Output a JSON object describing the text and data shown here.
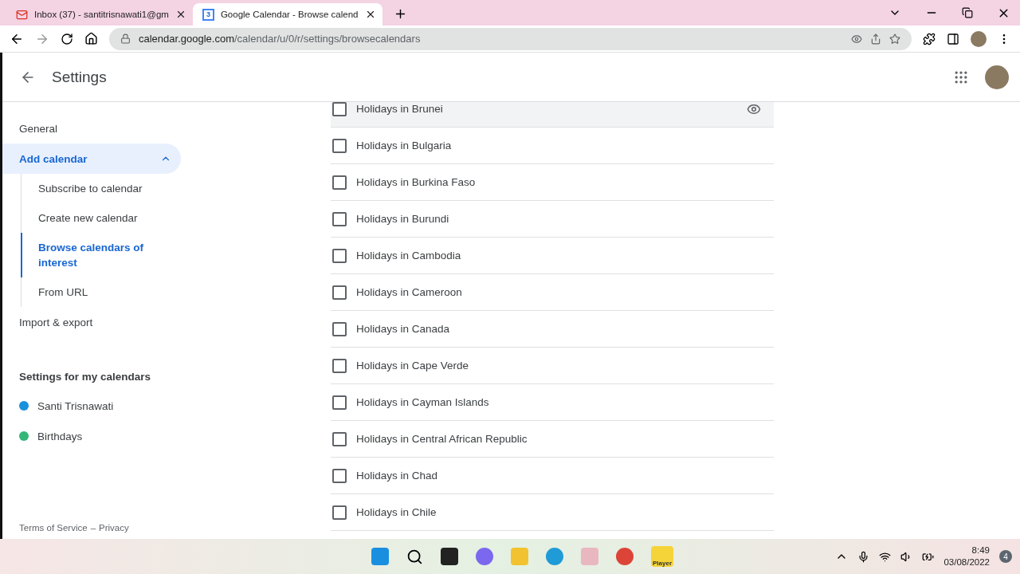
{
  "browser": {
    "tabs": [
      {
        "title": "Inbox (37) - santitrisnawati1@gm",
        "selected": false,
        "kind": "mail"
      },
      {
        "title": "Google Calendar - Browse calend",
        "selected": true,
        "kind": "calendar",
        "icon_text": "3"
      }
    ],
    "url_host": "calendar.google.com",
    "url_path": "/calendar/u/0/r/settings/browsecalendars"
  },
  "header": {
    "title": "Settings"
  },
  "sidebar": {
    "nav": [
      {
        "label": "General",
        "selected": false
      },
      {
        "label": "Add calendar",
        "selected": true,
        "expanded": true,
        "children": [
          {
            "label": "Subscribe to calendar",
            "selected": false
          },
          {
            "label": "Create new calendar",
            "selected": false
          },
          {
            "label": "Browse calendars of interest",
            "selected": true
          },
          {
            "label": "From URL",
            "selected": false
          }
        ]
      },
      {
        "label": "Import & export",
        "selected": false
      }
    ],
    "section_title": "Settings for my calendars",
    "calendars": [
      {
        "name": "Santi Trisnawati",
        "color": "#1a8fdc"
      },
      {
        "name": "Birthdays",
        "color": "#33b679"
      }
    ],
    "footer_terms": "Terms of Service",
    "footer_sep": "–",
    "footer_privacy": "Privacy"
  },
  "holidays": [
    {
      "label": "Holidays in Brunei",
      "checked": false,
      "hovered": true
    },
    {
      "label": "Holidays in Bulgaria",
      "checked": false,
      "hovered": false
    },
    {
      "label": "Holidays in Burkina Faso",
      "checked": false,
      "hovered": false
    },
    {
      "label": "Holidays in Burundi",
      "checked": false,
      "hovered": false
    },
    {
      "label": "Holidays in Cambodia",
      "checked": false,
      "hovered": false
    },
    {
      "label": "Holidays in Cameroon",
      "checked": false,
      "hovered": false
    },
    {
      "label": "Holidays in Canada",
      "checked": false,
      "hovered": false
    },
    {
      "label": "Holidays in Cape Verde",
      "checked": false,
      "hovered": false
    },
    {
      "label": "Holidays in Cayman Islands",
      "checked": false,
      "hovered": false
    },
    {
      "label": "Holidays in Central African Republic",
      "checked": false,
      "hovered": false
    },
    {
      "label": "Holidays in Chad",
      "checked": false,
      "hovered": false
    },
    {
      "label": "Holidays in Chile",
      "checked": false,
      "hovered": false
    }
  ],
  "taskbar": {
    "player_label": "Player",
    "time": "8:49",
    "date": "03/08/2022",
    "notifications": "4"
  }
}
